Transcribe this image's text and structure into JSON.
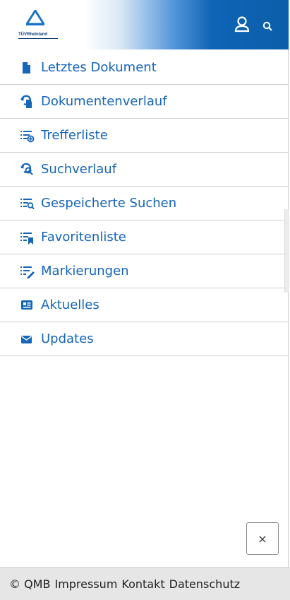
{
  "header": {
    "logo_text": "TÜVRheinland",
    "user_icon": "user-icon",
    "search_icon": "search-icon",
    "accent_color": "#0b5ea9"
  },
  "menu": {
    "items": [
      {
        "label": "Letztes Dokument",
        "icon": "document-icon"
      },
      {
        "label": "Dokumentenverlauf",
        "icon": "document-history-icon"
      },
      {
        "label": "Trefferliste",
        "icon": "hit-list-icon"
      },
      {
        "label": "Suchverlauf",
        "icon": "search-history-icon"
      },
      {
        "label": "Gespeicherte Suchen",
        "icon": "saved-searches-icon"
      },
      {
        "label": "Favoritenliste",
        "icon": "favorites-list-icon"
      },
      {
        "label": "Markierungen",
        "icon": "markings-icon"
      },
      {
        "label": "Aktuelles",
        "icon": "news-icon"
      },
      {
        "label": "Updates",
        "icon": "envelope-icon"
      }
    ],
    "link_color": "#1565b8"
  },
  "close_button": {
    "label": "×"
  },
  "footer": {
    "copyright": "© QMB",
    "links": [
      "Impressum",
      "Kontakt",
      "Datenschutz"
    ]
  }
}
